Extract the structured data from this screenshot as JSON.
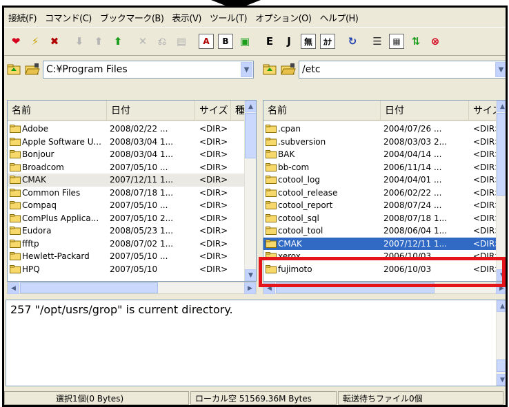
{
  "colors": {
    "highlight_box": "#e5141b",
    "selection_blue": "#316ac5",
    "folder_yellow": "#f6d86b"
  },
  "menu": [
    {
      "label": "接続(F)"
    },
    {
      "label": "コマンド(C)"
    },
    {
      "label": "ブックマーク(B)"
    },
    {
      "label": "表示(V)"
    },
    {
      "label": "ツール(T)"
    },
    {
      "label": "オプション(O)"
    },
    {
      "label": "ヘルプ(H)"
    }
  ],
  "toolbar": [
    {
      "icon": "connect-icon",
      "glyph": "❤",
      "color": "#d4001c"
    },
    {
      "icon": "quick-connect-icon",
      "glyph": "⚡",
      "color": "#c7a400"
    },
    {
      "icon": "disconnect-icon",
      "glyph": "✖",
      "color": "#b00000"
    },
    {
      "icon": "download-icon",
      "glyph": "⬇",
      "color": "#b5b5b5"
    },
    {
      "icon": "upload-icon",
      "glyph": "⬆",
      "color": "#b5b5b5"
    },
    {
      "icon": "mirror-upload-icon",
      "glyph": "⬆",
      "color": "#1a9e1a"
    },
    {
      "icon": "delete-icon",
      "glyph": "✕",
      "color": "#b5b5b5"
    },
    {
      "icon": "rename-icon",
      "glyph": "⎌",
      "color": "#b5b5b5"
    },
    {
      "icon": "mkdir-icon",
      "glyph": "▤",
      "color": "#b5b5b5"
    },
    {
      "icon": "ascii-mode-icon",
      "glyph": "A",
      "color": "#b00000",
      "boxed": true
    },
    {
      "icon": "binary-mode-icon",
      "glyph": "B",
      "color": "#000",
      "boxed": true
    },
    {
      "icon": "auto-mode-icon",
      "glyph": "▣",
      "color": "#1a9e1a"
    },
    {
      "icon": "euc-icon",
      "glyph": "E",
      "color": "#000"
    },
    {
      "icon": "jis-icon",
      "glyph": "J",
      "color": "#000"
    },
    {
      "icon": "no-convert-icon",
      "glyph": "無",
      "color": "#000",
      "boxed": true
    },
    {
      "icon": "kana-icon",
      "glyph": "ｶﾅ",
      "color": "#000",
      "boxed": true
    },
    {
      "icon": "refresh-icon",
      "glyph": "↻",
      "color": "#2040b0"
    },
    {
      "icon": "list-view-icon",
      "glyph": "☰",
      "color": "#333"
    },
    {
      "icon": "detail-view-icon",
      "glyph": "▦",
      "color": "#333",
      "boxed": true
    },
    {
      "icon": "compare-icon",
      "glyph": "⇅",
      "color": "#1a9e1a"
    },
    {
      "icon": "stop-icon",
      "glyph": "⊗",
      "color": "#d4001c"
    }
  ],
  "local": {
    "path": "C:¥Program Files",
    "headers": {
      "name": "名前",
      "date": "日付",
      "size": "サイズ",
      "type": "種"
    },
    "files": [
      {
        "name": "Adobe",
        "date": "2008/02/22  ...",
        "size": "<DIR>"
      },
      {
        "name": "Apple Software U...",
        "date": "2008/03/04 1...",
        "size": "<DIR>"
      },
      {
        "name": "Bonjour",
        "date": "2008/03/04 1...",
        "size": "<DIR>"
      },
      {
        "name": "Broadcom",
        "date": "2007/05/10  ...",
        "size": "<DIR>"
      },
      {
        "name": "CMAK",
        "date": "2007/12/11 1...",
        "size": "<DIR>",
        "selected": "gray"
      },
      {
        "name": "Common Files",
        "date": "2008/07/18 1...",
        "size": "<DIR>"
      },
      {
        "name": "Compaq",
        "date": "2007/05/10  ...",
        "size": "<DIR>"
      },
      {
        "name": "ComPlus Applica...",
        "date": "2007/05/10 2...",
        "size": "<DIR>"
      },
      {
        "name": "Eudora",
        "date": "2008/05/23 1...",
        "size": "<DIR>"
      },
      {
        "name": "ffftp",
        "date": "2008/07/02 1...",
        "size": "<DIR>"
      },
      {
        "name": "Hewlett-Packard",
        "date": "2007/05/10  ...",
        "size": "<DIR>"
      },
      {
        "name": "HPQ",
        "date": "2007/05/10",
        "size": "<DIR>"
      }
    ]
  },
  "remote": {
    "path": "/etc",
    "headers": {
      "name": "名前",
      "date": "日付",
      "size": "サイズ"
    },
    "files": [
      {
        "name": ".cpan",
        "date": "2004/07/26  ...",
        "size": "<DIR>"
      },
      {
        "name": ".subversion",
        "date": "2008/03/03 2...",
        "size": "<DIR>"
      },
      {
        "name": "BAK",
        "date": "2004/04/14  ...",
        "size": "<DIR>"
      },
      {
        "name": "bb-com",
        "date": "2006/11/14  ...",
        "size": "<DIR>"
      },
      {
        "name": "cotool_log",
        "date": "2004/04/01  ...",
        "size": "<DIR>"
      },
      {
        "name": "cotool_release",
        "date": "2006/02/22  ...",
        "size": "<DIR>"
      },
      {
        "name": "cotool_report",
        "date": "2008/07/24  ...",
        "size": "<DIR>"
      },
      {
        "name": "cotool_sql",
        "date": "2008/07/18 1...",
        "size": "<DIR>"
      },
      {
        "name": "cotool_tool",
        "date": "2008/06/04 1...",
        "size": "<DIR>"
      },
      {
        "name": "CMAK",
        "date": "2007/12/11 1...",
        "size": "<DIR>",
        "selected": "blue"
      },
      {
        "name": "xerox",
        "date": "2006/10/03  ...",
        "size": "<DIR>"
      },
      {
        "name": "fujimoto",
        "date": "2006/10/03",
        "size": "<DIR>"
      }
    ]
  },
  "log": {
    "text": "257 \"/opt/usrs/grop\" is current directory."
  },
  "status": {
    "selection": "選択1個(0 Bytes)",
    "local_free": "ローカル空 51569.36M Bytes",
    "queue": "転送待ちファイル0個"
  }
}
